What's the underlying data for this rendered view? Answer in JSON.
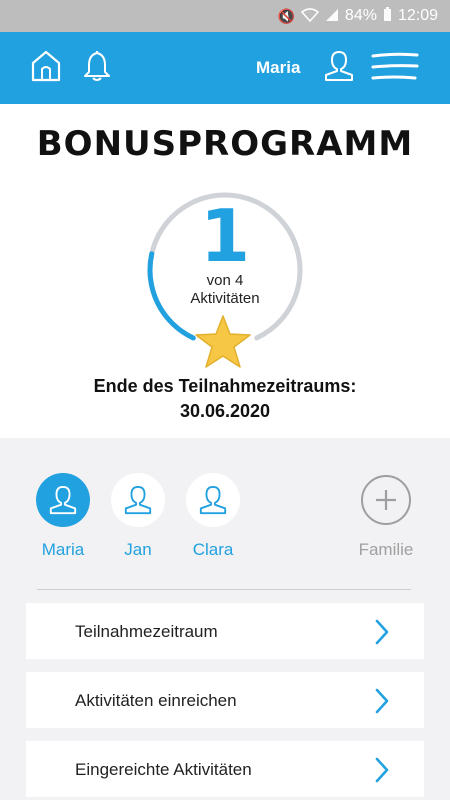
{
  "status_bar": {
    "battery": "84%",
    "time": "12:09",
    "icons": [
      "mute-icon",
      "wifi-icon",
      "signal-icon",
      "battery-icon"
    ]
  },
  "header": {
    "user_name": "Maria",
    "icons": [
      "home-icon",
      "bell-icon",
      "user-icon",
      "menu-icon"
    ],
    "accent_color": "#22a1e0"
  },
  "bonus": {
    "title": "BONUSPROGRAMM",
    "completed": "1",
    "of_label": "von 4",
    "activities_label": "Aktivitäten",
    "progress_fraction": 0.25,
    "end_label": "Ende des Teilnahmezeitraums:",
    "end_date": "30.06.2020"
  },
  "members": [
    {
      "name": "Maria",
      "active": true
    },
    {
      "name": "Jan",
      "active": false
    },
    {
      "name": "Clara",
      "active": false
    }
  ],
  "add_member_label": "Familie",
  "menu_items": [
    {
      "label": "Teilnahmezeitraum"
    },
    {
      "label": "Aktivitäten einreichen"
    },
    {
      "label": "Eingereichte Aktivitäten"
    }
  ]
}
